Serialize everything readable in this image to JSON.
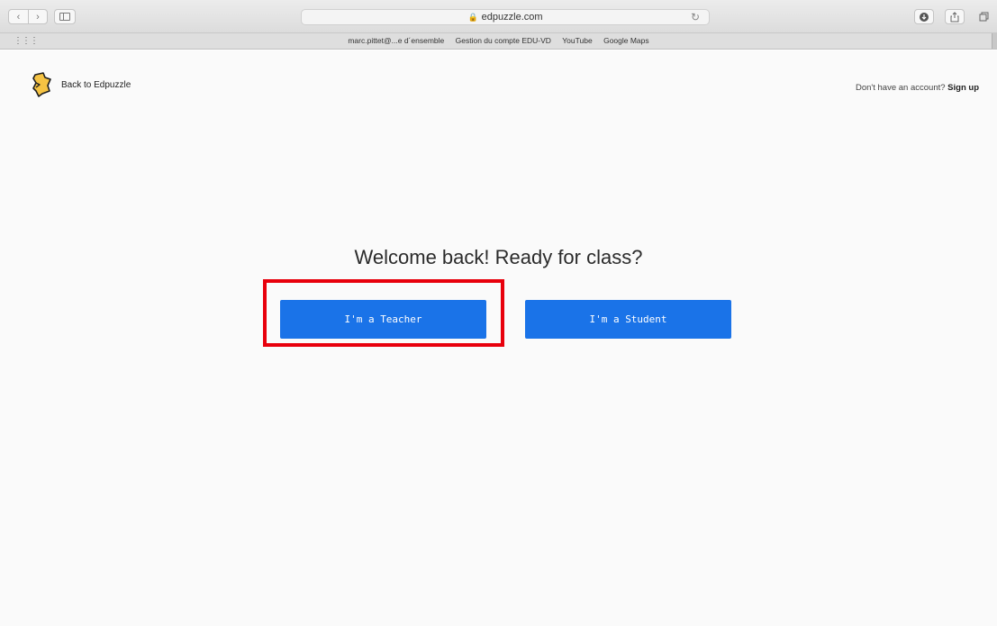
{
  "browser": {
    "url": "edpuzzle.com",
    "favorites": [
      "marc.pittet@...e d´ensemble",
      "Gestion du compte EDU-VD",
      "YouTube",
      "Google Maps"
    ]
  },
  "header": {
    "back_label": "Back to Edpuzzle",
    "signup_prompt": "Don't have an account?",
    "signup_link": "Sign up"
  },
  "main": {
    "title": "Welcome back! Ready for class?",
    "teacher_button": "I'm a Teacher",
    "student_button": "I'm a Student"
  },
  "colors": {
    "primary_button": "#1a73e8",
    "highlight_box": "#e8000c",
    "logo_fill": "#f5c343"
  },
  "icons": [
    "back-icon",
    "forward-icon",
    "sidebar-icon",
    "lock-icon",
    "reload-icon",
    "download-icon",
    "share-icon",
    "tabs-icon",
    "favorites-grid-icon",
    "edpuzzle-logo-icon"
  ]
}
